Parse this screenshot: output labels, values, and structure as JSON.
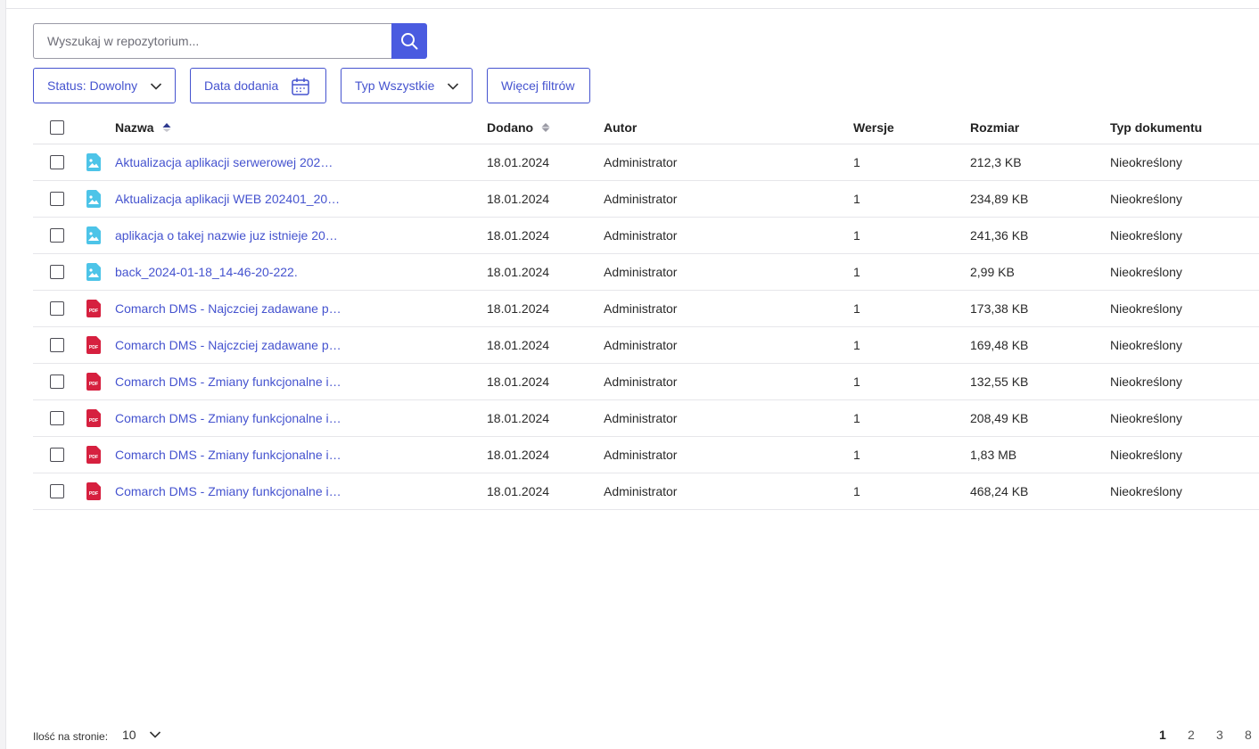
{
  "search": {
    "placeholder": "Wyszukaj w repozytorium...",
    "value": ""
  },
  "filters": {
    "status_label": "Status: Dowolny",
    "date_label": "Data dodania",
    "type_label": "Typ Wszystkie",
    "more_label": "Więcej filtrów"
  },
  "table": {
    "columns": [
      "Nazwa",
      "Dodano",
      "Autor",
      "Wersje",
      "Rozmiar",
      "Typ dokumentu"
    ],
    "rows": [
      {
        "icon": "image-file-icon",
        "name": "Aktualizacja aplikacji serwerowej 202…",
        "added": "18.01.2024",
        "author": "Administrator",
        "versions": "1",
        "size": "212,3 KB",
        "doctype": "Nieokreślony"
      },
      {
        "icon": "image-file-icon",
        "name": "Aktualizacja aplikacji WEB 202401_20…",
        "added": "18.01.2024",
        "author": "Administrator",
        "versions": "1",
        "size": "234,89 KB",
        "doctype": "Nieokreślony"
      },
      {
        "icon": "image-file-icon",
        "name": "aplikacja o takej nazwie juz istnieje 20…",
        "added": "18.01.2024",
        "author": "Administrator",
        "versions": "1",
        "size": "241,36 KB",
        "doctype": "Nieokreślony"
      },
      {
        "icon": "image-file-icon",
        "name": "back_2024-01-18_14-46-20-222.",
        "added": "18.01.2024",
        "author": "Administrator",
        "versions": "1",
        "size": "2,99 KB",
        "doctype": "Nieokreślony"
      },
      {
        "icon": "pdf-file-icon",
        "name": "Comarch DMS - Najczciej zadawane p…",
        "added": "18.01.2024",
        "author": "Administrator",
        "versions": "1",
        "size": "173,38 KB",
        "doctype": "Nieokreślony"
      },
      {
        "icon": "pdf-file-icon",
        "name": "Comarch DMS - Najczciej zadawane p…",
        "added": "18.01.2024",
        "author": "Administrator",
        "versions": "1",
        "size": "169,48 KB",
        "doctype": "Nieokreślony"
      },
      {
        "icon": "pdf-file-icon",
        "name": "Comarch DMS - Zmiany funkcjonalne i…",
        "added": "18.01.2024",
        "author": "Administrator",
        "versions": "1",
        "size": "132,55 KB",
        "doctype": "Nieokreślony"
      },
      {
        "icon": "pdf-file-icon",
        "name": "Comarch DMS - Zmiany funkcjonalne i…",
        "added": "18.01.2024",
        "author": "Administrator",
        "versions": "1",
        "size": "208,49 KB",
        "doctype": "Nieokreślony"
      },
      {
        "icon": "pdf-file-icon",
        "name": "Comarch DMS - Zmiany funkcjonalne i…",
        "added": "18.01.2024",
        "author": "Administrator",
        "versions": "1",
        "size": "1,83 MB",
        "doctype": "Nieokreślony"
      },
      {
        "icon": "pdf-file-icon",
        "name": "Comarch DMS - Zmiany funkcjonalne i…",
        "added": "18.01.2024",
        "author": "Administrator",
        "versions": "1",
        "size": "468,24 KB",
        "doctype": "Nieokreślony"
      }
    ],
    "pdf_badge": "PDF"
  },
  "footer": {
    "per_page_label": "Ilość na stronie:",
    "per_page_value": "10",
    "pages": [
      "1",
      "2",
      "3",
      "8"
    ],
    "current_page": "1"
  },
  "colors": {
    "accent": "#4553cf",
    "search_button": "#4a5be0",
    "image_icon": "#4dc4e8",
    "pdf_icon": "#d6203f"
  }
}
